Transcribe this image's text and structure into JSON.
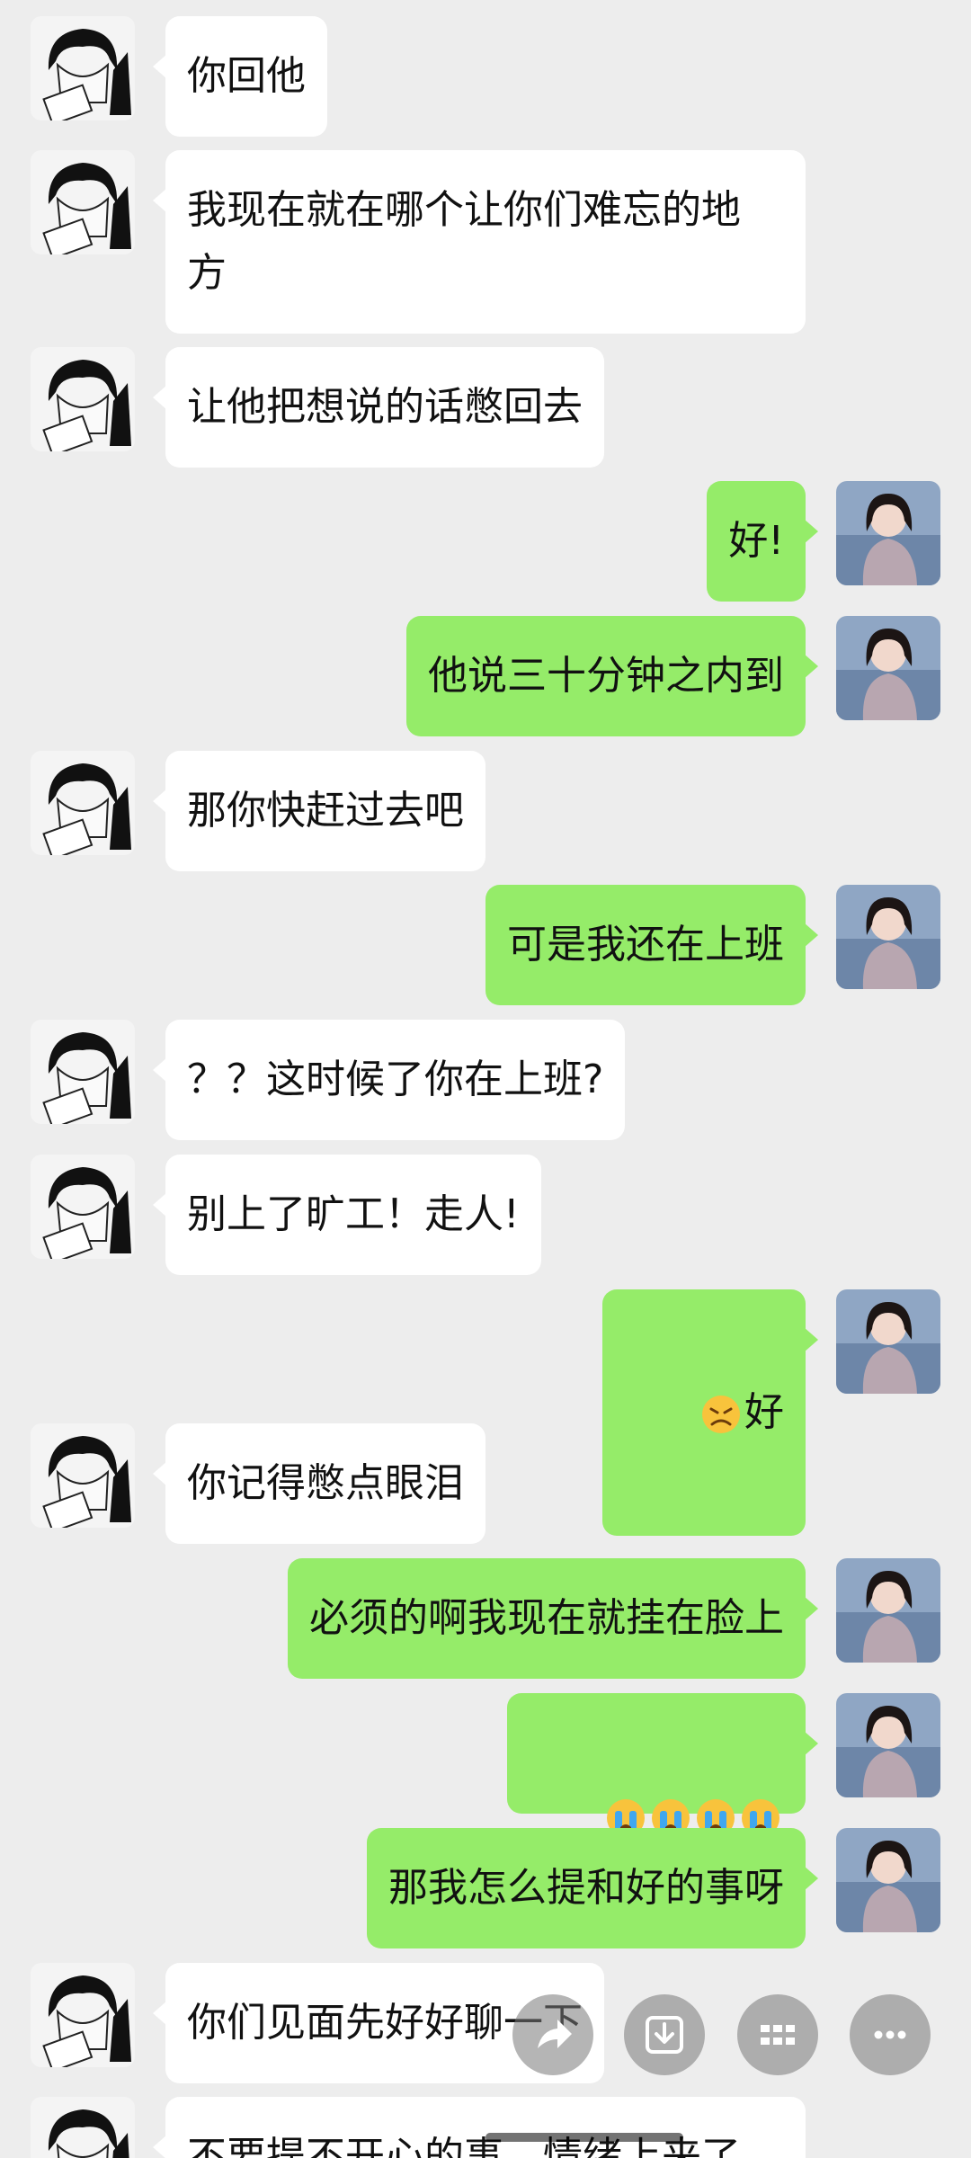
{
  "colors": {
    "background": "#ededed",
    "incoming_bubble": "#ffffff",
    "outgoing_bubble": "#95ec69",
    "text": "#111111"
  },
  "messages": [
    {
      "side": "in",
      "text": "你回他"
    },
    {
      "side": "in",
      "text": "我现在就在哪个让你们难忘的地\n方"
    },
    {
      "side": "in",
      "text": "让他把想说的话憋回去"
    },
    {
      "side": "out",
      "text": "好!"
    },
    {
      "side": "out",
      "text": "他说三十分钟之内到"
    },
    {
      "side": "in",
      "text": "那你快赶过去吧"
    },
    {
      "side": "out",
      "text": "可是我还在上班"
    },
    {
      "side": "in",
      "text": "？？这时候了你在上班?"
    },
    {
      "side": "in",
      "text": "别上了旷工！走人!"
    },
    {
      "side": "out",
      "emoji": "persevering-face",
      "text": "好"
    },
    {
      "side": "in",
      "text": "你记得憋点眼泪"
    },
    {
      "side": "out",
      "text": "必须的啊我现在就挂在脸上"
    },
    {
      "side": "out",
      "emoji_row": [
        "crying-face",
        "crying-face",
        "crying-face",
        "crying-face"
      ],
      "text": ""
    },
    {
      "side": "out",
      "text": "那我怎么提和好的事呀"
    },
    {
      "side": "in",
      "text": "你们见面先好好聊一下"
    },
    {
      "side": "in",
      "text": "不要提不开心的事，情绪上来了"
    }
  ],
  "actions": [
    {
      "icon": "share-icon"
    },
    {
      "icon": "download-icon"
    },
    {
      "icon": "grid-icon"
    },
    {
      "icon": "more-icon"
    }
  ]
}
